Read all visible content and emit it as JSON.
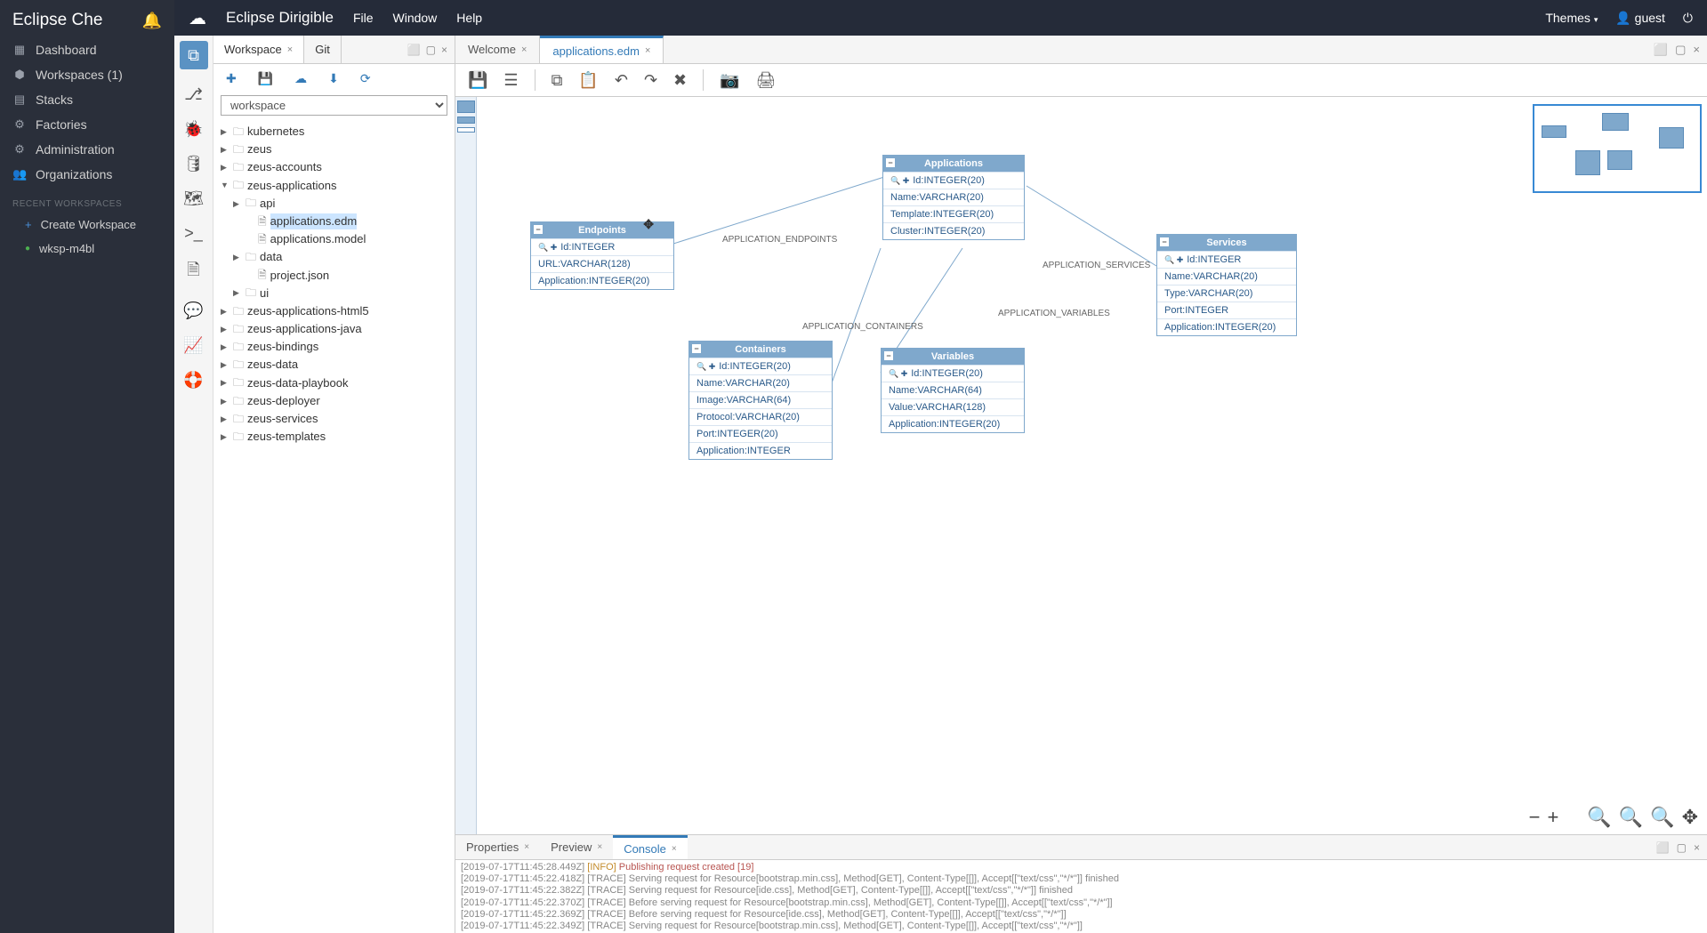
{
  "che": {
    "title": "Eclipse Che",
    "nav": {
      "dashboard": "Dashboard",
      "workspaces": "Workspaces (1)",
      "stacks": "Stacks",
      "factories": "Factories",
      "administration": "Administration",
      "organizations": "Organizations"
    },
    "recent_label": "RECENT WORKSPACES",
    "create_workspace": "Create Workspace",
    "recent_ws": "wksp-m4bl"
  },
  "top": {
    "app": "Eclipse Dirigible",
    "menu_file": "File",
    "menu_window": "Window",
    "menu_help": "Help",
    "themes": "Themes",
    "user": "guest"
  },
  "sidebar_tabs": {
    "workspace": "Workspace",
    "git": "Git"
  },
  "workspace_select": "workspace",
  "tree": {
    "kubernetes": "kubernetes",
    "zeus": "zeus",
    "zeus_accounts": "zeus-accounts",
    "zeus_applications": "zeus-applications",
    "api": "api",
    "applications_edm": "applications.edm",
    "applications_model": "applications.model",
    "data": "data",
    "project_json": "project.json",
    "ui": "ui",
    "zeus_applications_html5": "zeus-applications-html5",
    "zeus_applications_java": "zeus-applications-java",
    "zeus_bindings": "zeus-bindings",
    "zeus_data": "zeus-data",
    "zeus_data_playbook": "zeus-data-playbook",
    "zeus_deployer": "zeus-deployer",
    "zeus_services": "zeus-services",
    "zeus_templates": "zeus-templates"
  },
  "editor_tabs": {
    "welcome": "Welcome",
    "applications_edm": "applications.edm"
  },
  "entities": {
    "endpoints": {
      "title": "Endpoints",
      "fields": [
        "Id:INTEGER",
        "URL:VARCHAR(128)",
        "Application:INTEGER(20)"
      ]
    },
    "applications": {
      "title": "Applications",
      "fields": [
        "Id:INTEGER(20)",
        "Name:VARCHAR(20)",
        "Template:INTEGER(20)",
        "Cluster:INTEGER(20)"
      ]
    },
    "containers": {
      "title": "Containers",
      "fields": [
        "Id:INTEGER(20)",
        "Name:VARCHAR(20)",
        "Image:VARCHAR(64)",
        "Protocol:VARCHAR(20)",
        "Port:INTEGER(20)",
        "Application:INTEGER"
      ]
    },
    "variables": {
      "title": "Variables",
      "fields": [
        "Id:INTEGER(20)",
        "Name:VARCHAR(64)",
        "Value:VARCHAR(128)",
        "Application:INTEGER(20)"
      ]
    },
    "services": {
      "title": "Services",
      "fields": [
        "Id:INTEGER",
        "Name:VARCHAR(20)",
        "Type:VARCHAR(20)",
        "Port:INTEGER",
        "Application:INTEGER(20)"
      ]
    }
  },
  "edges": {
    "endpoints": "APPLICATION_ENDPOINTS",
    "containers": "APPLICATION_CONTAINERS",
    "variables": "APPLICATION_VARIABLES",
    "services": "APPLICATION_SERVICES"
  },
  "bottom_tabs": {
    "properties": "Properties",
    "preview": "Preview",
    "console": "Console"
  },
  "console": [
    {
      "ts": "[2019-07-17T11:45:28.449Z]",
      "lvl": "[INFO]",
      "msg": "Publishing request created [19]",
      "hl": true
    },
    {
      "ts": "[2019-07-17T11:45:22.418Z]",
      "lvl": "[TRACE]",
      "msg": "Serving request for Resource[bootstrap.min.css], Method[GET], Content-Type[[]], Accept[[\"text/css\",\"*/*\"]] finished"
    },
    {
      "ts": "[2019-07-17T11:45:22.382Z]",
      "lvl": "[TRACE]",
      "msg": "Serving request for Resource[ide.css], Method[GET], Content-Type[[]], Accept[[\"text/css\",\"*/*\"]] finished"
    },
    {
      "ts": "[2019-07-17T11:45:22.370Z]",
      "lvl": "[TRACE]",
      "msg": "Before serving request for Resource[bootstrap.min.css], Method[GET], Content-Type[[]], Accept[[\"text/css\",\"*/*\"]]"
    },
    {
      "ts": "[2019-07-17T11:45:22.369Z]",
      "lvl": "[TRACE]",
      "msg": "Before serving request for Resource[ide.css], Method[GET], Content-Type[[]], Accept[[\"text/css\",\"*/*\"]]"
    },
    {
      "ts": "[2019-07-17T11:45:22.349Z]",
      "lvl": "[TRACE]",
      "msg": "Serving request for Resource[bootstrap.min.css], Method[GET], Content-Type[[]], Accept[[\"text/css\",\"*/*\"]]"
    }
  ]
}
